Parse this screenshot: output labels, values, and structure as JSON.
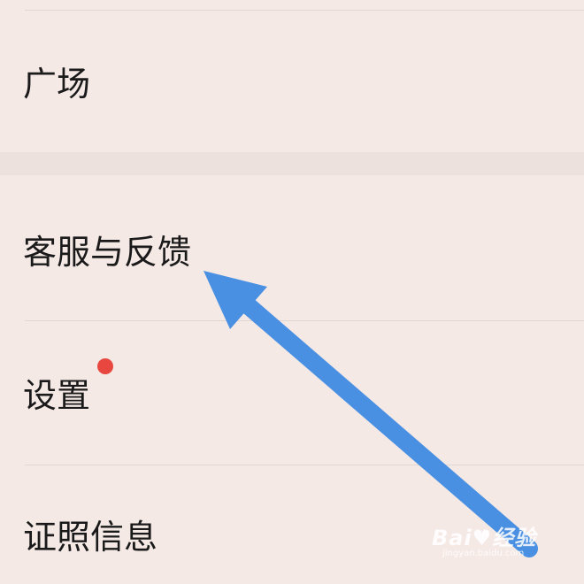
{
  "menu": {
    "items": [
      {
        "label": "广场"
      },
      {
        "label": "客服与反馈"
      },
      {
        "label": "设置",
        "has_badge": true
      },
      {
        "label": "证照信息"
      }
    ]
  },
  "colors": {
    "background": "#f5e9e6",
    "badge": "#e8473f",
    "arrow": "#4a90e2"
  },
  "annotation": {
    "icon": "arrow-pointer-icon"
  },
  "watermark": {
    "brand": "Bai♥经验",
    "url": "jingyan.baidu.com"
  }
}
